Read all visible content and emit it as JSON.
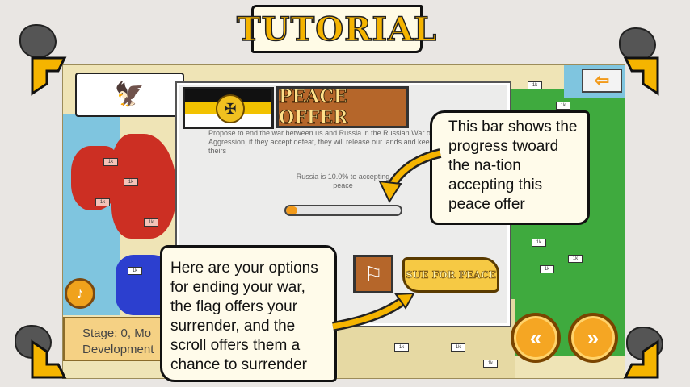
{
  "tutorial": {
    "title": "TUTORIAL"
  },
  "map": {
    "troop_label": "1k"
  },
  "hud": {
    "stage_line1": "Stage: 0, Mo",
    "stage_line2": "Development"
  },
  "peace_dialog": {
    "header": "PEACE OFFER",
    "description": "Propose to end the war between us and Russia in the Russian War of Aggression, if they accept defeat, they will release our lands and keep theirs",
    "acceptance_text": "Russia is 10.0% to accepting peace",
    "acceptance_fraction": 0.1,
    "sue_for_peace_label": "SUE FOR PEACE"
  },
  "callouts": {
    "progress": "This bar shows the progress twoard the na-tion accepting this peace offer",
    "options": "Here are your options for ending your war, the flag offers your surrender, and the scroll offers them a chance to surrender"
  },
  "colors": {
    "accent": "#f5a623",
    "bar_fill": "#f29a1a",
    "callout_bg": "#fffbea"
  },
  "icons": {
    "flag_banner": "prussian-eagle-icon",
    "music": "music-note-icon",
    "surrender": "white-flag-icon",
    "back": "back-arrow-icon",
    "prev": "double-chevron-left-icon",
    "next": "double-chevron-right-icon"
  }
}
